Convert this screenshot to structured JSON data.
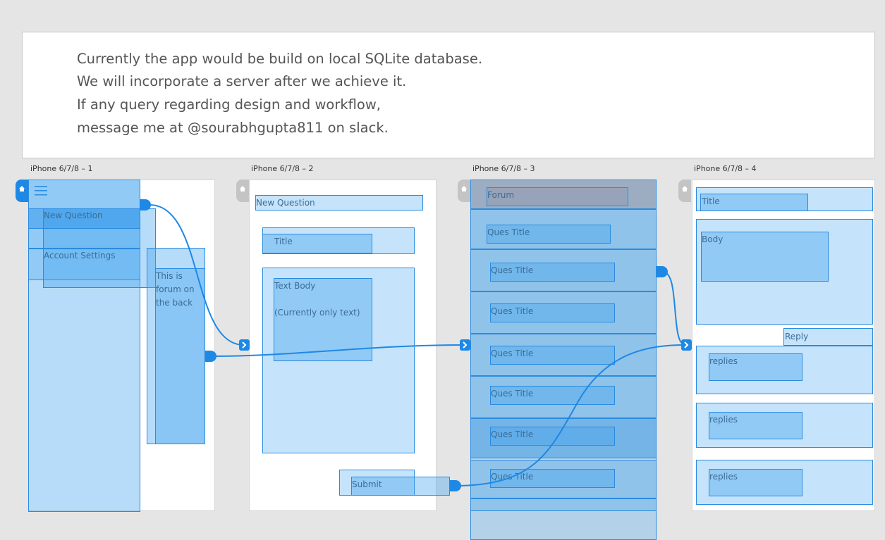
{
  "note": {
    "lines": [
      "Currently the app would be build on local SQLite database.",
      "We will incorporate a server after we achieve it.",
      "If any query regarding design and workflow,",
      "message me at @sourabhgupta811 on slack."
    ]
  },
  "artboards": [
    {
      "label": "iPhone 6/7/8 – 1",
      "menu": {
        "new_question": "New Question",
        "account_settings": "Account Settings"
      },
      "drawer_text": [
        "This is",
        "forum on",
        "the back"
      ]
    },
    {
      "label": "iPhone 6/7/8 – 2",
      "header": "New Question",
      "title_field": "Title",
      "body_field": "Text Body",
      "body_note": "(Currently only text)",
      "submit": "Submit"
    },
    {
      "label": "iPhone 6/7/8 – 3",
      "header": "Forum",
      "questions": [
        "Ques Title",
        "Ques Title",
        "Ques Title",
        "Ques Title",
        "Ques Title",
        "Ques Title",
        "Ques Title"
      ]
    },
    {
      "label": "iPhone 6/7/8 – 4",
      "title_field": "Title",
      "body_field": "Body",
      "reply": "Reply",
      "replies": [
        "replies",
        "replies",
        "replies"
      ]
    }
  ],
  "colors": {
    "hotspot": "#40a3ee",
    "wire": "#1e88e5",
    "background": "#e5e5e5"
  }
}
